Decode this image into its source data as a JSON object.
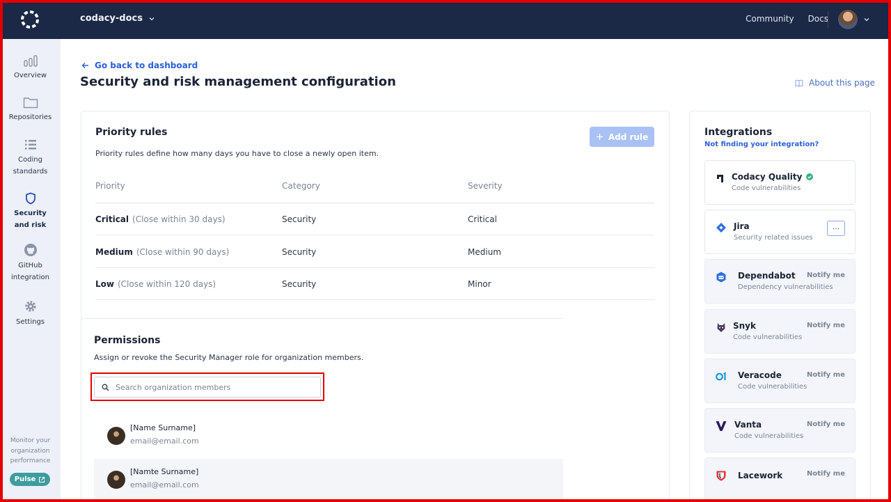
{
  "topbar": {
    "org_name": "codacy-docs",
    "nav": [
      "Community",
      "Docs"
    ]
  },
  "sidebar": {
    "items": [
      {
        "label": "Overview"
      },
      {
        "label": "Repositories"
      },
      {
        "label": "Coding standards"
      },
      {
        "label": "Security and risk"
      },
      {
        "label": "GitHub integration"
      },
      {
        "label": "Settings"
      }
    ],
    "monitor_text": "Monitor your organization performance",
    "pulse_label": "Pulse"
  },
  "page": {
    "back_label": "Go back to dashboard",
    "title": "Security and risk management configuration",
    "about_label": "About this page"
  },
  "priority": {
    "title": "Priority rules",
    "description": "Priority rules define how many days you have to close a newly open item.",
    "add_rule_label": "Add rule",
    "headers": [
      "Priority",
      "Category",
      "Severity"
    ],
    "rows": [
      {
        "priority": "Critical",
        "hint": "(Close within 30 days)",
        "category": "Security",
        "severity": "Critical"
      },
      {
        "priority": "Medium",
        "hint": "(Close within 90 days)",
        "category": "Security",
        "severity": "Medium"
      },
      {
        "priority": "Low",
        "hint": "(Close within 120 days)",
        "category": "Security",
        "severity": "Minor"
      }
    ]
  },
  "permissions": {
    "title": "Permissions",
    "description": "Assign or revoke the Security Manager role for organization members.",
    "search_placeholder": "Search organization members",
    "members": [
      {
        "name": "[Name Surname]",
        "email": "email@email.com"
      },
      {
        "name": "[Namte Surname]",
        "email": "email@email.com"
      }
    ]
  },
  "integrations": {
    "title": "Integrations",
    "link": "Not finding your integration?",
    "items": [
      {
        "name": "Codacy Quality",
        "sub": "Code vulnerabilities"
      },
      {
        "name": "Jira",
        "sub": "Security related issues",
        "more": "···"
      },
      {
        "name": "Dependabot",
        "sub": "Dependency vulnerabilities",
        "action": "Notify me"
      },
      {
        "name": "Snyk",
        "sub": "Code vulnerabilities",
        "action": "Notify me"
      },
      {
        "name": "Veracode",
        "sub": "Code vulnerabilities",
        "action": "Notify me"
      },
      {
        "name": "Vanta",
        "sub": "Code vulnerabilities",
        "action": "Notify me"
      },
      {
        "name": "Lacework",
        "action": "Notify me"
      }
    ]
  },
  "colors": {
    "topbar": "#1b2846",
    "sidebar": "#edf0f8",
    "link": "#2b5fd9",
    "add_rule": "#a9c1f5",
    "pulse": "#3d9c9e",
    "highlight": "#e30000"
  }
}
